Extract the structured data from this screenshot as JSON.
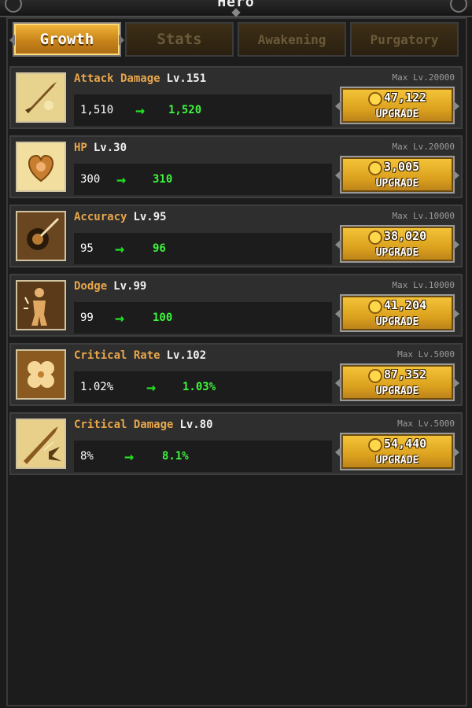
{
  "header": {
    "title": "Hero"
  },
  "tabs": [
    {
      "label": "Growth",
      "active": true
    },
    {
      "label": "Stats",
      "active": false
    },
    {
      "label": "Awakening",
      "active": false
    },
    {
      "label": "Purgatory",
      "active": false
    }
  ],
  "stats": [
    {
      "name": "Attack Damage",
      "level": "Lv.151",
      "max": "Max Lv.20000",
      "current": "1,510",
      "next": "1,520",
      "cost": "47,122",
      "button": "UPGRADE",
      "icon": "sword-icon"
    },
    {
      "name": "HP",
      "level": "Lv.30",
      "max": "Max Lv.20000",
      "current": "300",
      "next": "310",
      "cost": "3,005",
      "button": "UPGRADE",
      "icon": "heart-icon"
    },
    {
      "name": "Accuracy",
      "level": "Lv.95",
      "max": "Max Lv.10000",
      "current": "95",
      "next": "96",
      "cost": "38,020",
      "button": "UPGRADE",
      "icon": "target-icon"
    },
    {
      "name": "Dodge",
      "level": "Lv.99",
      "max": "Max Lv.10000",
      "current": "99",
      "next": "100",
      "cost": "41,204",
      "button": "UPGRADE",
      "icon": "figure-icon"
    },
    {
      "name": "Critical Rate",
      "level": "Lv.102",
      "max": "Max Lv.5000",
      "current": "1.02%",
      "next": "1.03%",
      "cost": "87,352",
      "button": "UPGRADE",
      "icon": "clover-icon"
    },
    {
      "name": "Critical Damage",
      "level": "Lv.80",
      "max": "Max Lv.5000",
      "current": "8%",
      "next": "8.1%",
      "cost": "54,440",
      "button": "UPGRADE",
      "icon": "blade-burst-icon"
    }
  ],
  "colors": {
    "accent": "#e8a64a",
    "upgrade_gold": "#dca21e",
    "increase_green": "#3df53d"
  }
}
